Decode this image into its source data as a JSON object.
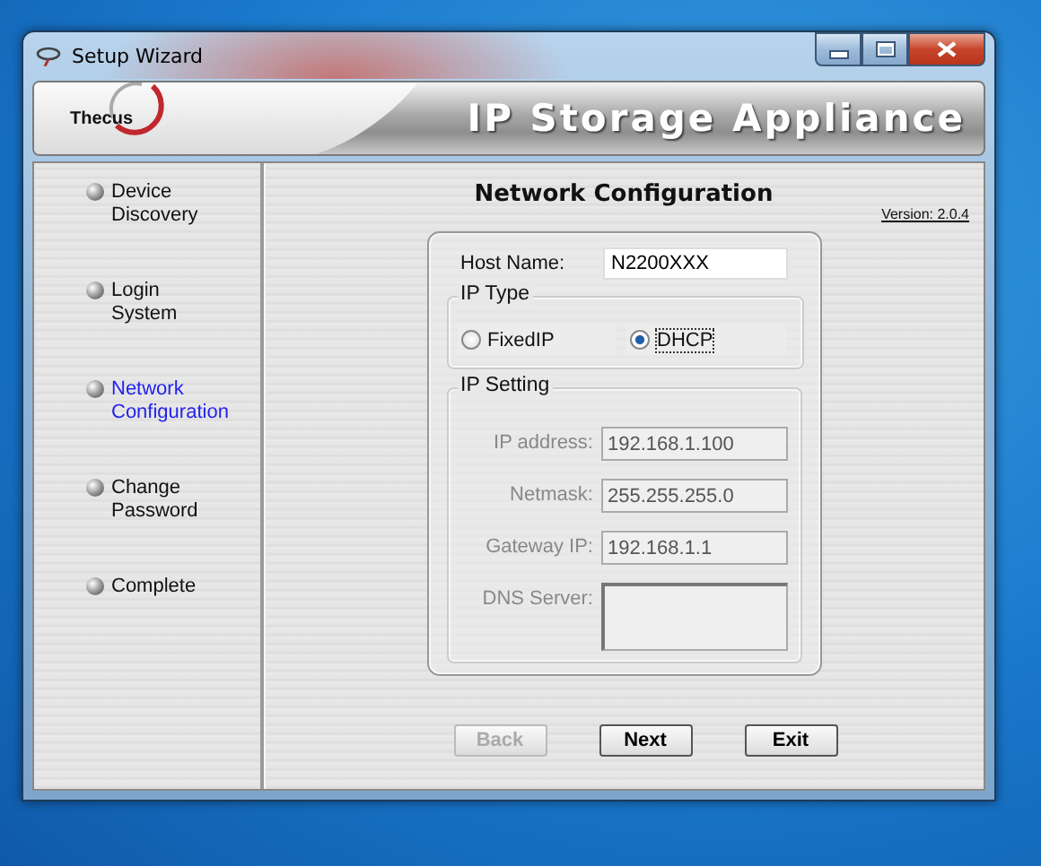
{
  "window": {
    "title": "Setup Wizard"
  },
  "banner": {
    "logo": "Thecus",
    "title": "IP Storage Appliance"
  },
  "steps": [
    {
      "label": "Device\nDiscovery",
      "selected": false
    },
    {
      "label": "Login\nSystem",
      "selected": false
    },
    {
      "label": "Network\nConfiguration",
      "selected": true
    },
    {
      "label": "Change\nPassword",
      "selected": false
    },
    {
      "label": "Complete",
      "selected": false
    }
  ],
  "page": {
    "title": "Network Configuration",
    "version": "Version: 2.0.4"
  },
  "host_name": {
    "label": "Host Name:",
    "value": "N2200XXX"
  },
  "ip_type": {
    "legend": "IP Type",
    "options": [
      {
        "label": "FixedIP",
        "selected": false
      },
      {
        "label": "DHCP",
        "selected": true
      }
    ]
  },
  "ip_setting": {
    "legend": "IP Setting",
    "fields": [
      {
        "label": "IP address:",
        "value": "192.168.1.100",
        "kind": "line",
        "disabled": true
      },
      {
        "label": "Netmask:",
        "value": "255.255.255.0",
        "kind": "line",
        "disabled": true
      },
      {
        "label": "Gateway IP:",
        "value": "192.168.1.1",
        "kind": "line",
        "disabled": true
      },
      {
        "label": "DNS Server:",
        "kind": "area",
        "disabled": true
      }
    ]
  },
  "buttons": [
    {
      "label": "Back",
      "disabled": true
    },
    {
      "label": "Next",
      "disabled": false
    },
    {
      "label": "Exit",
      "disabled": false
    }
  ]
}
